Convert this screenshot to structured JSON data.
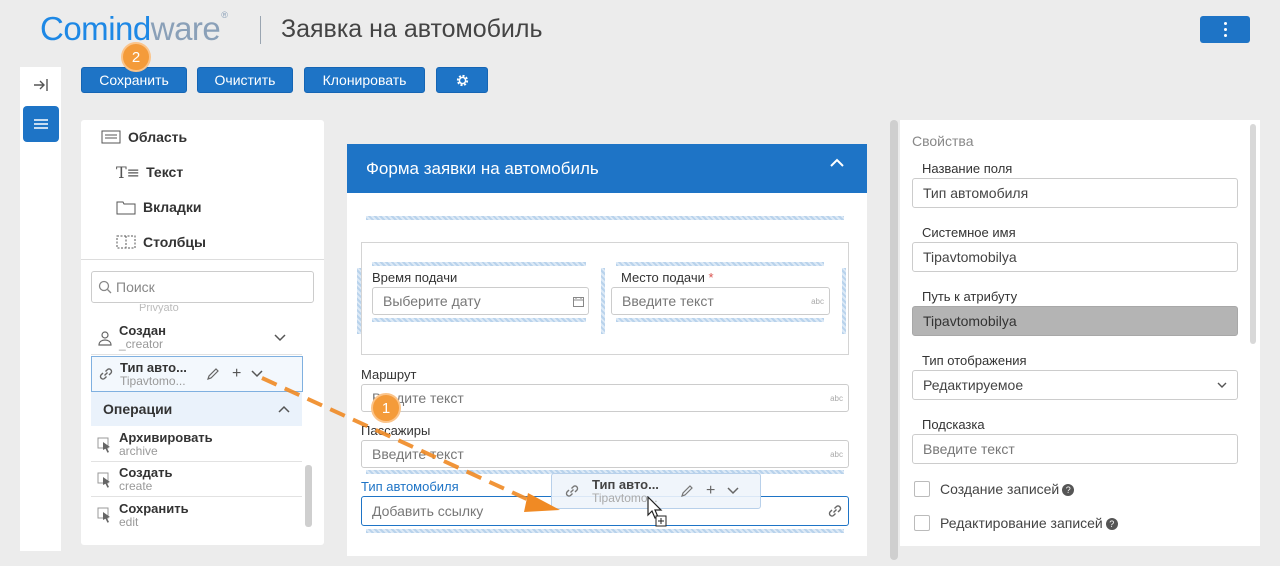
{
  "header": {
    "logo_part1": "Com",
    "logo_part2": "ind",
    "logo_part3": "ware",
    "logo_reg": "®",
    "title": "Заявка на автомобиль"
  },
  "toolbar": {
    "save": "Сохранить",
    "clear": "Очистить",
    "clone": "Клонировать",
    "step_badge": "2"
  },
  "palette": {
    "items": [
      "Область",
      "Текст",
      "Вкладки",
      "Столбцы"
    ],
    "search_placeholder": "Поиск",
    "cut_text": "Privyato",
    "attributes": [
      {
        "title": "Создан",
        "sys": "_creator"
      },
      {
        "title": "Тип авто...",
        "sys": "Tipavtomo..."
      }
    ],
    "operations_header": "Операции",
    "operations": [
      {
        "title": "Архивировать",
        "sys": "archive"
      },
      {
        "title": "Создать",
        "sys": "create"
      },
      {
        "title": "Сохранить",
        "sys": "edit"
      }
    ]
  },
  "form": {
    "title": "Форма заявки на автомобиль",
    "fields": {
      "pickup_time": {
        "label": "Время подачи",
        "placeholder": "Выберите дату"
      },
      "pickup_place": {
        "label": "Место подачи",
        "required": "*",
        "placeholder": "Введите текст",
        "suffix": "abc"
      },
      "route": {
        "label": "Маршрут",
        "placeholder": "Введите текст",
        "suffix": "abc"
      },
      "passengers": {
        "label": "Пассажиры",
        "placeholder": "Введите текст",
        "suffix": "abc"
      },
      "car_type": {
        "label": "Тип автомобиля",
        "placeholder": "Добавить ссылку"
      }
    },
    "ghost": {
      "title": "Тип авто...",
      "sys": "Tipavtomo..."
    },
    "step_badge": "1"
  },
  "properties": {
    "title": "Свойства",
    "field_name_label": "Название поля",
    "field_name_value": "Тип автомобиля",
    "system_name_label": "Системное имя",
    "system_name_value": "Tipavtomobilya",
    "attr_path_label": "Путь к атрибуту",
    "attr_path_value": "Tipavtomobilya",
    "display_type_label": "Тип отображения",
    "display_type_value": "Редактируемое",
    "hint_label": "Подсказка",
    "hint_placeholder": "Введите текст",
    "create_records": "Создание записей",
    "edit_records": "Редактирование записей"
  },
  "colors": {
    "accent": "#1e74c6",
    "badge": "#f49b3a",
    "drag_arrow": "#f08a24"
  }
}
